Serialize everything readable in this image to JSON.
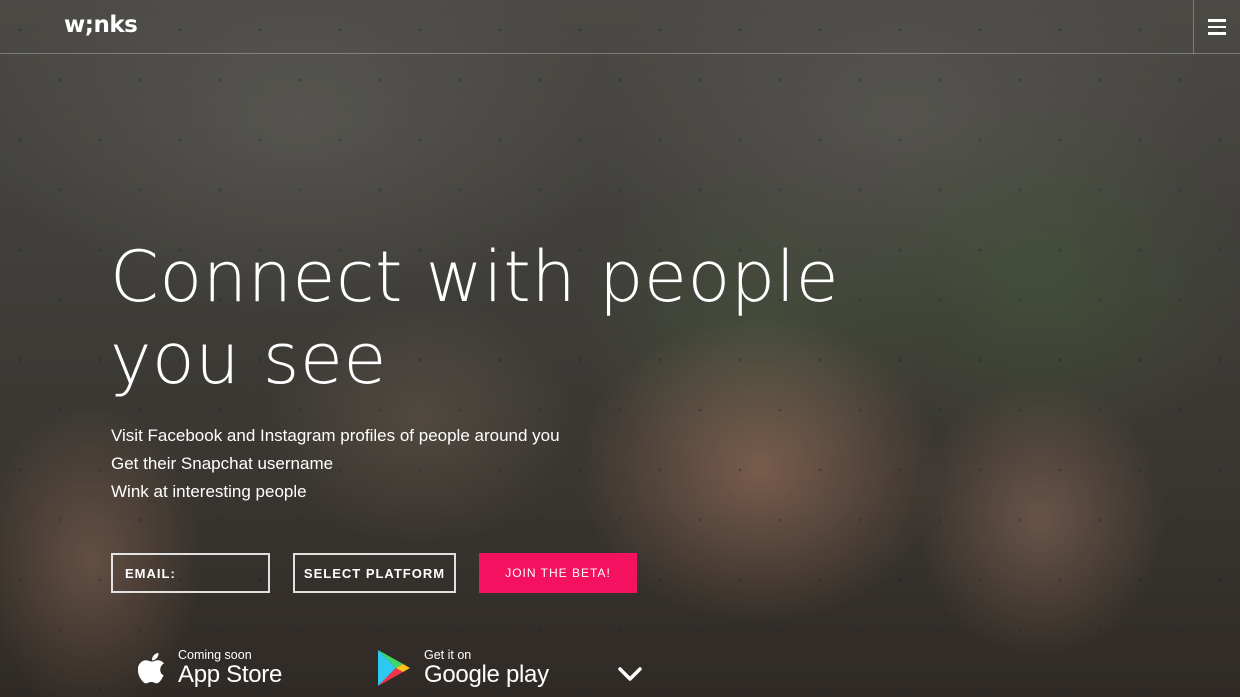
{
  "header": {
    "logo_text": "w;nks",
    "menu_icon": "hamburger-icon"
  },
  "hero": {
    "headline_line1": "Connect with people",
    "headline_line2": "you see",
    "features": [
      "Visit Facebook and Instagram profiles of people around you",
      "Get their Snapchat username",
      "Wink at interesting people"
    ]
  },
  "signup": {
    "email_placeholder": "EMAIL:",
    "platform_label": "SELECT PLATFORM",
    "join_label": "JOIN THE BETA!",
    "accent_color": "#f4115f"
  },
  "stores": {
    "appstore_small": "Coming soon",
    "appstore_big": "App Store",
    "appstore_icon": "apple-icon",
    "googleplay_small": "Get it on",
    "googleplay_big": "Google play",
    "googleplay_icon": "google-play-icon"
  },
  "scroll_icon": "chevron-down-icon"
}
